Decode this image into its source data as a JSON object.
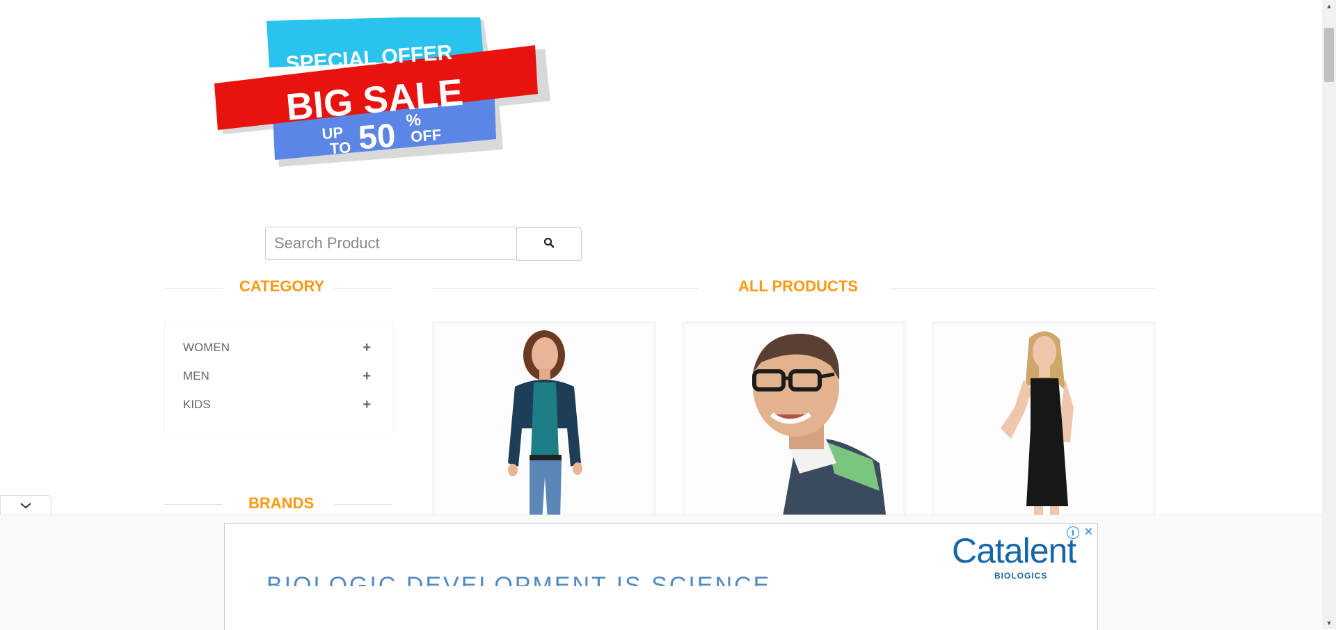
{
  "banner": {
    "line1": "SPECIAL OFFER",
    "line2": "BIG SALE",
    "up_to": "UP",
    "to": "TO",
    "percent": "50",
    "percent_sign": "%",
    "off": "OFF"
  },
  "search": {
    "placeholder": "Search Product",
    "button_icon": "search-icon"
  },
  "sections": {
    "category_title": "CATEGORY",
    "products_title": "ALL PRODUCTS",
    "brands_title": "BRANDS"
  },
  "categories": [
    {
      "label": "WOMEN",
      "icon": "plus-icon"
    },
    {
      "label": "MEN",
      "icon": "plus-icon"
    },
    {
      "label": "KIDS",
      "icon": "plus-icon"
    }
  ],
  "products": [
    {
      "image": "woman-casual-outfit"
    },
    {
      "image": "man-glasses-smiling"
    },
    {
      "image": "woman-black-dress"
    }
  ],
  "ad": {
    "headline": "BIOLOGIC DEVELOPMENT IS SCIENCE",
    "brand": "Catalent",
    "brand_sub": "BIOLOGICS",
    "info_icon": "i",
    "close_icon": "✕"
  },
  "colors": {
    "accent": "#FE980F",
    "ad_blue": "#1565a8"
  }
}
